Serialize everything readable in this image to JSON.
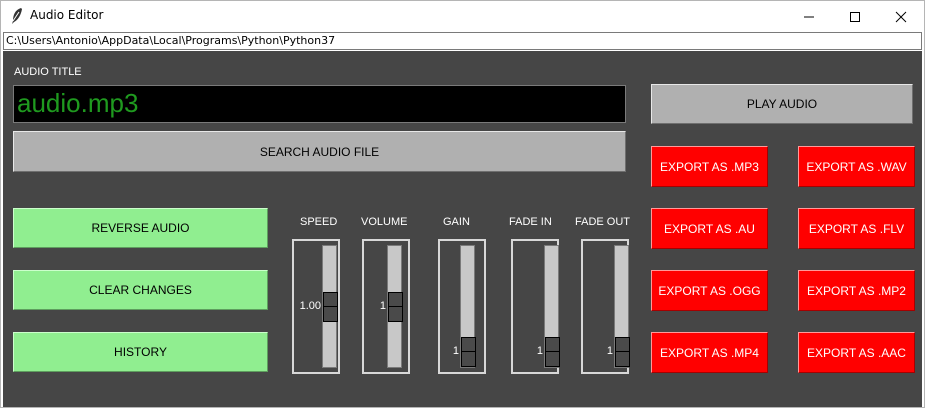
{
  "window": {
    "title": "Audio Editor"
  },
  "path": "C:\\Users\\Antonio\\AppData\\Local\\Programs\\Python\\Python37",
  "audio_title": {
    "label": "AUDIO TITLE",
    "value": "audio.mp3"
  },
  "buttons": {
    "search": "SEARCH AUDIO FILE",
    "play": "PLAY AUDIO",
    "reverse": "REVERSE AUDIO",
    "clear": "CLEAR CHANGES",
    "history": "HISTORY"
  },
  "exports": [
    "EXPORT AS .MP3",
    "EXPORT AS .WAV",
    "EXPORT AS .AU",
    "EXPORT AS .FLV",
    "EXPORT AS .OGG",
    "EXPORT AS .MP2",
    "EXPORT AS .MP4",
    "EXPORT AS .AAC"
  ],
  "sliders": [
    {
      "label": "SPEED",
      "value": "1.00",
      "level": 0.5
    },
    {
      "label": "VOLUME",
      "value": "1",
      "level": 0.5
    },
    {
      "label": "GAIN",
      "value": "1",
      "level": 1.0
    },
    {
      "label": "FADE IN",
      "value": "1",
      "level": 1.0
    },
    {
      "label": "FADE OUT",
      "value": "1",
      "level": 1.0
    }
  ],
  "colors": {
    "background": "#464646",
    "green_button": "#90ee90",
    "red_button": "#ff0000",
    "title_text": "#1f9a1f"
  }
}
